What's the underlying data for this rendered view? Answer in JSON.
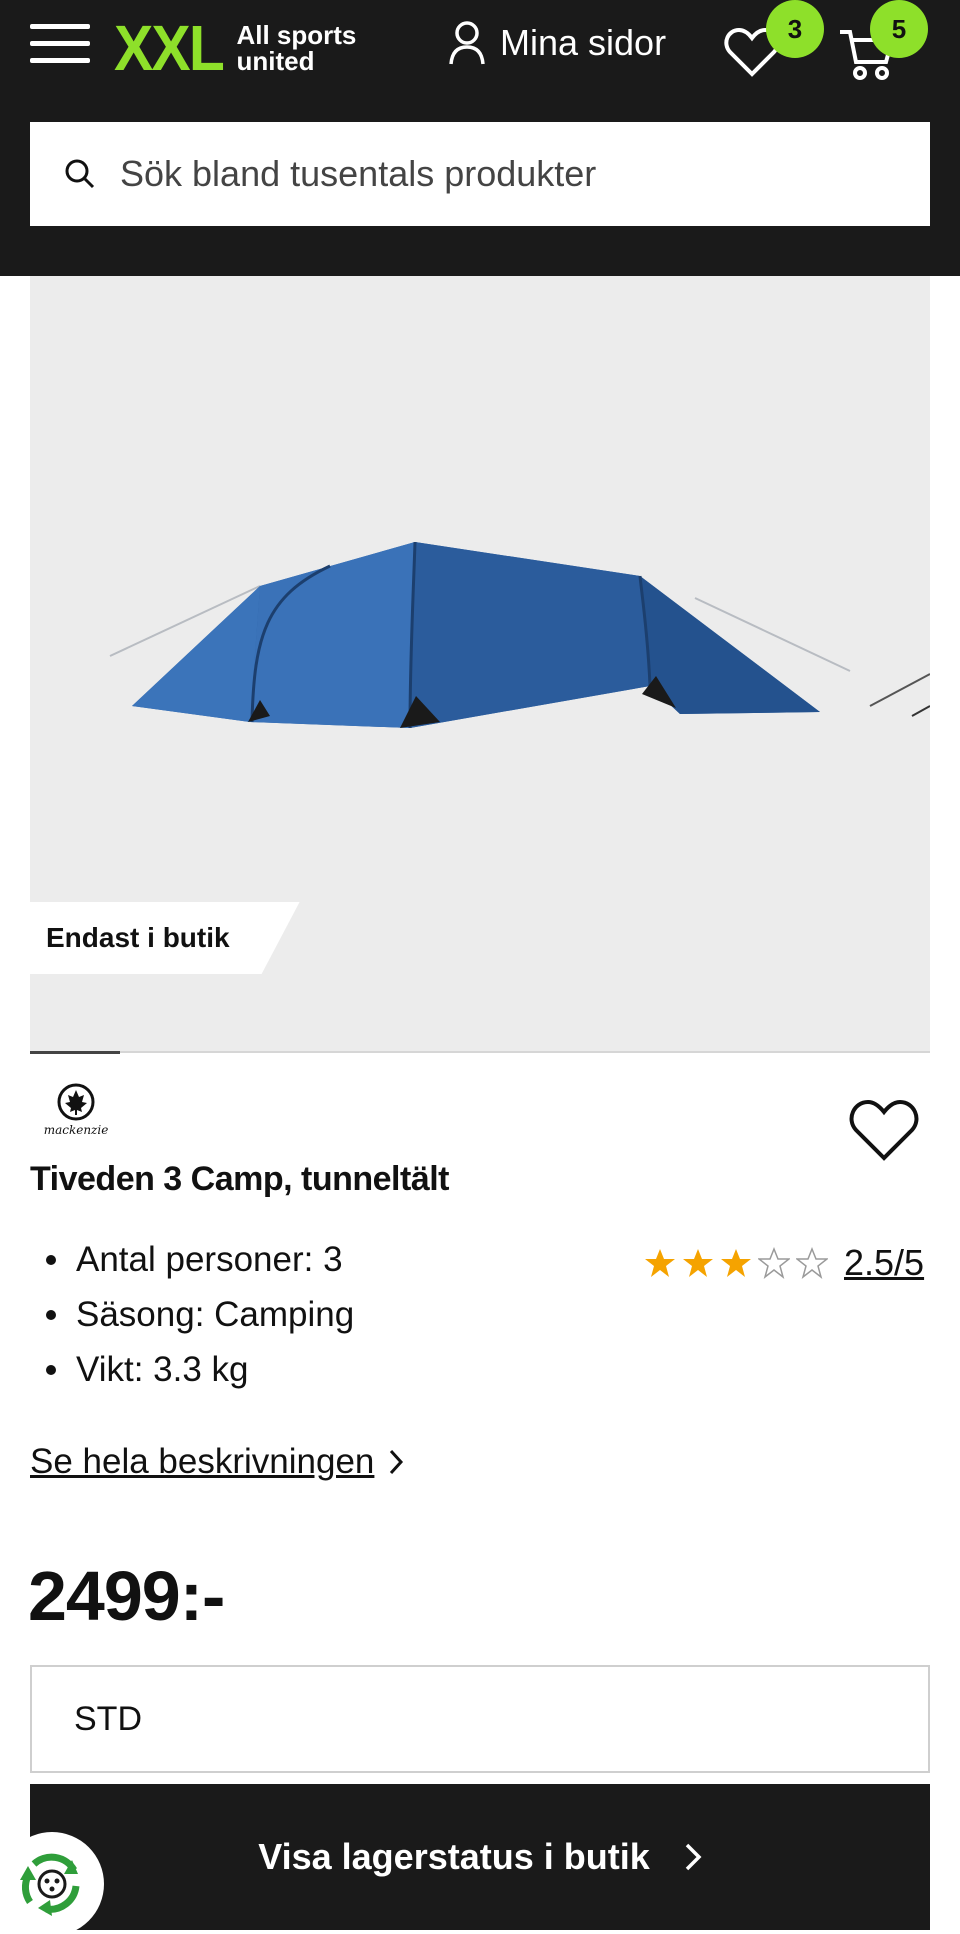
{
  "header": {
    "logo_mark": "XXL",
    "logo_tagline_line1": "All sports",
    "logo_tagline_line2": "united",
    "account_label": "Mina sidor",
    "wishlist_count": "3",
    "cart_count": "5",
    "accent_color": "#8ee02a",
    "background_color": "#1a1a1a"
  },
  "search": {
    "placeholder": "Sök bland tusentals produkter"
  },
  "product": {
    "image_badge": "Endast i butik",
    "brand": "mackenzie",
    "title": "Tiveden 3 Camp, tunneltält",
    "features": [
      "Antal personer: 3",
      "Säsong: Camping",
      "Vikt: 3.3 kg"
    ],
    "rating_value": 2.5,
    "rating_label": "2.5/5",
    "rating_filled_stars": 3,
    "rating_total_stars": 5,
    "description_link": "Se hela beskrivningen",
    "price": "2499:-",
    "variant": "STD",
    "stock_button_label": "Visa lagerstatus i butik",
    "star_color": "#f5a300"
  },
  "icons": [
    "menu-icon",
    "user-icon",
    "heart-icon",
    "cart-icon",
    "search-icon",
    "chevron-right-icon",
    "recycle-icon"
  ]
}
